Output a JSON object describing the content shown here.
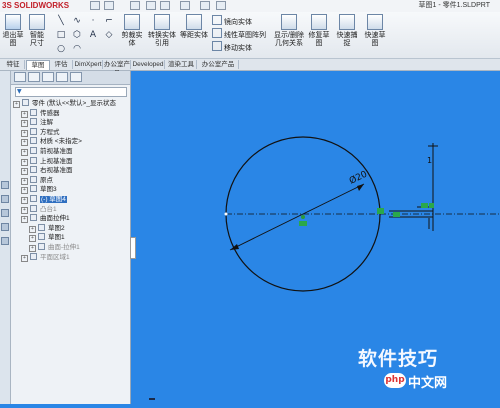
{
  "app": {
    "logo": "SOLIDWORKS",
    "title": "草图1 - 零件1.SLDPRT"
  },
  "ribbon": {
    "buttons": [
      {
        "label": "退出草图"
      },
      {
        "label": "智能尺寸"
      },
      {
        "label": "剪裁实体"
      },
      {
        "label": "转换实体引用"
      },
      {
        "label": "等距实体"
      },
      {
        "label": "镜向实体"
      },
      {
        "label": "线性草图阵列"
      },
      {
        "label": "移动实体"
      },
      {
        "label": "显示/删除几何关系"
      },
      {
        "label": "修复草图"
      },
      {
        "label": "快速捕捉"
      },
      {
        "label": "快速草图"
      }
    ]
  },
  "tabs": [
    {
      "label": "特征"
    },
    {
      "label": "草图"
    },
    {
      "label": "评估"
    },
    {
      "label": "DimXpert"
    },
    {
      "label": "办公室产品"
    },
    {
      "label": "Developed"
    },
    {
      "label": "渲染工具"
    },
    {
      "label": "办公室产品"
    }
  ],
  "tree": {
    "filter_icon": "filter-icon",
    "items": [
      {
        "label": "零件 (默认<<默认>_显示状态",
        "level": 0
      },
      {
        "label": "传感器",
        "level": 1
      },
      {
        "label": "注解",
        "level": 1
      },
      {
        "label": "方程式",
        "level": 1
      },
      {
        "label": "材质 <未指定>",
        "level": 1
      },
      {
        "label": "前视基准面",
        "level": 1
      },
      {
        "label": "上视基准面",
        "level": 1
      },
      {
        "label": "右视基准面",
        "level": 1
      },
      {
        "label": "原点",
        "level": 1
      },
      {
        "label": "草图3",
        "level": 1
      },
      {
        "label": "(-) 草图4",
        "level": 1
      },
      {
        "label": "凸台1",
        "level": 1
      },
      {
        "label": "曲面拉伸1",
        "level": 1
      },
      {
        "label": "草图2",
        "level": 2
      },
      {
        "label": "草图1",
        "level": 2
      },
      {
        "label": "曲面-拉伸1",
        "level": 2
      },
      {
        "label": "平面区域1",
        "level": 1
      }
    ]
  },
  "sketch": {
    "dimension": "Ø20",
    "vertical_dim": "1"
  },
  "watermark": {
    "text": "软件技巧",
    "php": "php",
    "cn": "中文网"
  }
}
